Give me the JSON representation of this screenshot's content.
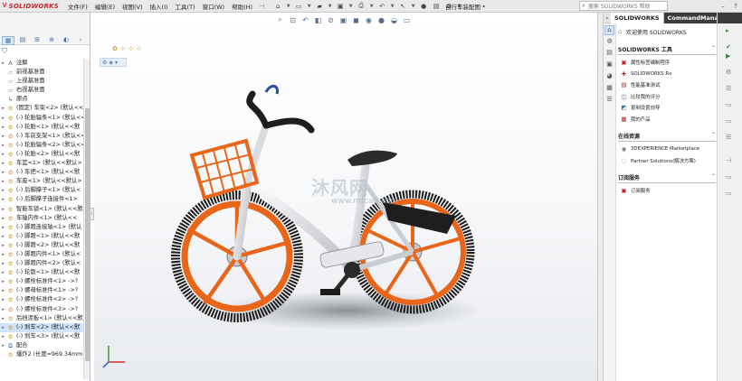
{
  "app": {
    "brand": "SOLIDWORKS",
    "menus": [
      "文件(F)",
      "编辑(E)",
      "视图(V)",
      "插入(I)",
      "工具(T)",
      "窗口(W)",
      "帮助(H)"
    ],
    "document_title": "自行车装配图 *",
    "search_placeholder": "搜索 SOLIDWORKS 帮助"
  },
  "feature_tree": {
    "items": [
      {
        "label": "注解",
        "icon": "annotation-icon",
        "expand": true
      },
      {
        "label": "前视基准面",
        "icon": "plane-icon",
        "expand": false
      },
      {
        "label": "上视基准面",
        "icon": "plane-icon",
        "expand": false
      },
      {
        "label": "右视基准面",
        "icon": "plane-icon",
        "expand": false
      },
      {
        "label": "原点",
        "icon": "origin-icon",
        "expand": false
      },
      {
        "label": "(固定) 车架<2> (默认<<",
        "icon": "part-icon",
        "expand": true
      },
      {
        "label": "(-) 轮胎辐条<1> (默认<<",
        "icon": "part-icon",
        "expand": true
      },
      {
        "label": "(-) 轮胎<1> (默认<<默",
        "icon": "part-icon",
        "expand": true
      },
      {
        "label": "(-) 车前支架<1> (默认<<",
        "icon": "part-icon",
        "expand": true
      },
      {
        "label": "(-) 轮胎辐条<2> (默认<<",
        "icon": "part-icon",
        "expand": true
      },
      {
        "label": "(-) 轮胎<2> (默认<<默",
        "icon": "part-icon",
        "expand": true
      },
      {
        "label": "车篮<1> (默认<<默认>",
        "icon": "part-icon",
        "expand": true
      },
      {
        "label": "(-) 车把<1> (默认<<默",
        "icon": "part-icon",
        "expand": true
      },
      {
        "label": "车座<1> (默认<<默认>",
        "icon": "part-icon",
        "expand": true
      },
      {
        "label": "(-) 后脚撑子<1> (默认<",
        "icon": "part-icon",
        "expand": true
      },
      {
        "label": "(-) 后脚撑子连接件<1>",
        "icon": "part-icon",
        "expand": true
      },
      {
        "label": "智能车锁<1> (默认<<默",
        "icon": "part-icon",
        "expand": true
      },
      {
        "label": "车轴内件<1> (默认<<",
        "icon": "part-icon",
        "expand": true
      },
      {
        "label": "(-) 脚蹬连接轴<1> (默认",
        "icon": "part-icon",
        "expand": true
      },
      {
        "label": "(-) 脚蹬<1> (默认<<默",
        "icon": "part-icon",
        "expand": true
      },
      {
        "label": "(-) 脚蹬<2> (默认<<默",
        "icon": "part-icon",
        "expand": true
      },
      {
        "label": "(-) 脚蹬内件<1> (默认<",
        "icon": "part-icon",
        "expand": true
      },
      {
        "label": "(-) 脚蹬内件<2> (默认<",
        "icon": "part-icon",
        "expand": true
      },
      {
        "label": "(-) 轮毂<1> (默认<<默",
        "icon": "part-icon",
        "expand": true
      },
      {
        "label": "(-) 螺栓标准件<1> ->?",
        "icon": "part-icon",
        "expand": true
      },
      {
        "label": "(-) 螺母标准件<1> ->?",
        "icon": "part-icon",
        "expand": true
      },
      {
        "label": "(-) 螺栓标准件<2> ->?",
        "icon": "part-icon",
        "expand": true
      },
      {
        "label": "(-) 螺栓标准件<3> ->?",
        "icon": "part-icon",
        "expand": true
      },
      {
        "label": "后挡泥板<1> (默认<<默",
        "icon": "part-icon",
        "expand": true
      },
      {
        "label": "(-) 刹车<2> (默认<<默",
        "icon": "part-icon",
        "expand": true,
        "selected": true
      },
      {
        "label": "(-) 刹车<3> (默认<<默",
        "icon": "part-icon",
        "expand": true
      },
      {
        "label": "配合",
        "icon": "mate-icon",
        "expand": true
      },
      {
        "label": "爆炸2 (长度=969.34mm",
        "icon": "part-icon",
        "expand": false
      }
    ]
  },
  "graphics": {
    "watermark": "沐风网",
    "watermark_sub": "www.mfcad.com",
    "colors": {
      "orange": "#e8651a",
      "frame": "#d5d7da",
      "dark": "#1e1e1e"
    }
  },
  "task_pane": {
    "tabs": {
      "solidworks": "SOLIDWORKS",
      "commandmanager": "CommandManager"
    },
    "welcome": "欢迎使用 SOLIDWORKS",
    "sections": [
      {
        "title": "SOLIDWORKS 工具",
        "items": [
          {
            "label": "属性标签编制程序",
            "icon": "tag-builder-icon"
          },
          {
            "label": "SOLIDWORKS Rx",
            "icon": "rx-icon"
          },
          {
            "label": "性能基准测试",
            "icon": "benchmark-icon"
          },
          {
            "label": "比较我的评分",
            "icon": "compare-icon"
          },
          {
            "label": "复制设置向导",
            "icon": "copy-settings-icon"
          },
          {
            "label": "我的产品",
            "icon": "products-icon"
          }
        ]
      },
      {
        "title": "在线资源",
        "items": [
          {
            "label": "3DEXPERIENCE Marketplace",
            "icon": "marketplace-icon"
          },
          {
            "label": "Partner Solutions(解决方案)",
            "icon": "partner-icon"
          }
        ]
      },
      {
        "title": "订阅服务",
        "items": [
          {
            "label": "订阅服务",
            "icon": "subscription-icon"
          }
        ]
      }
    ]
  }
}
